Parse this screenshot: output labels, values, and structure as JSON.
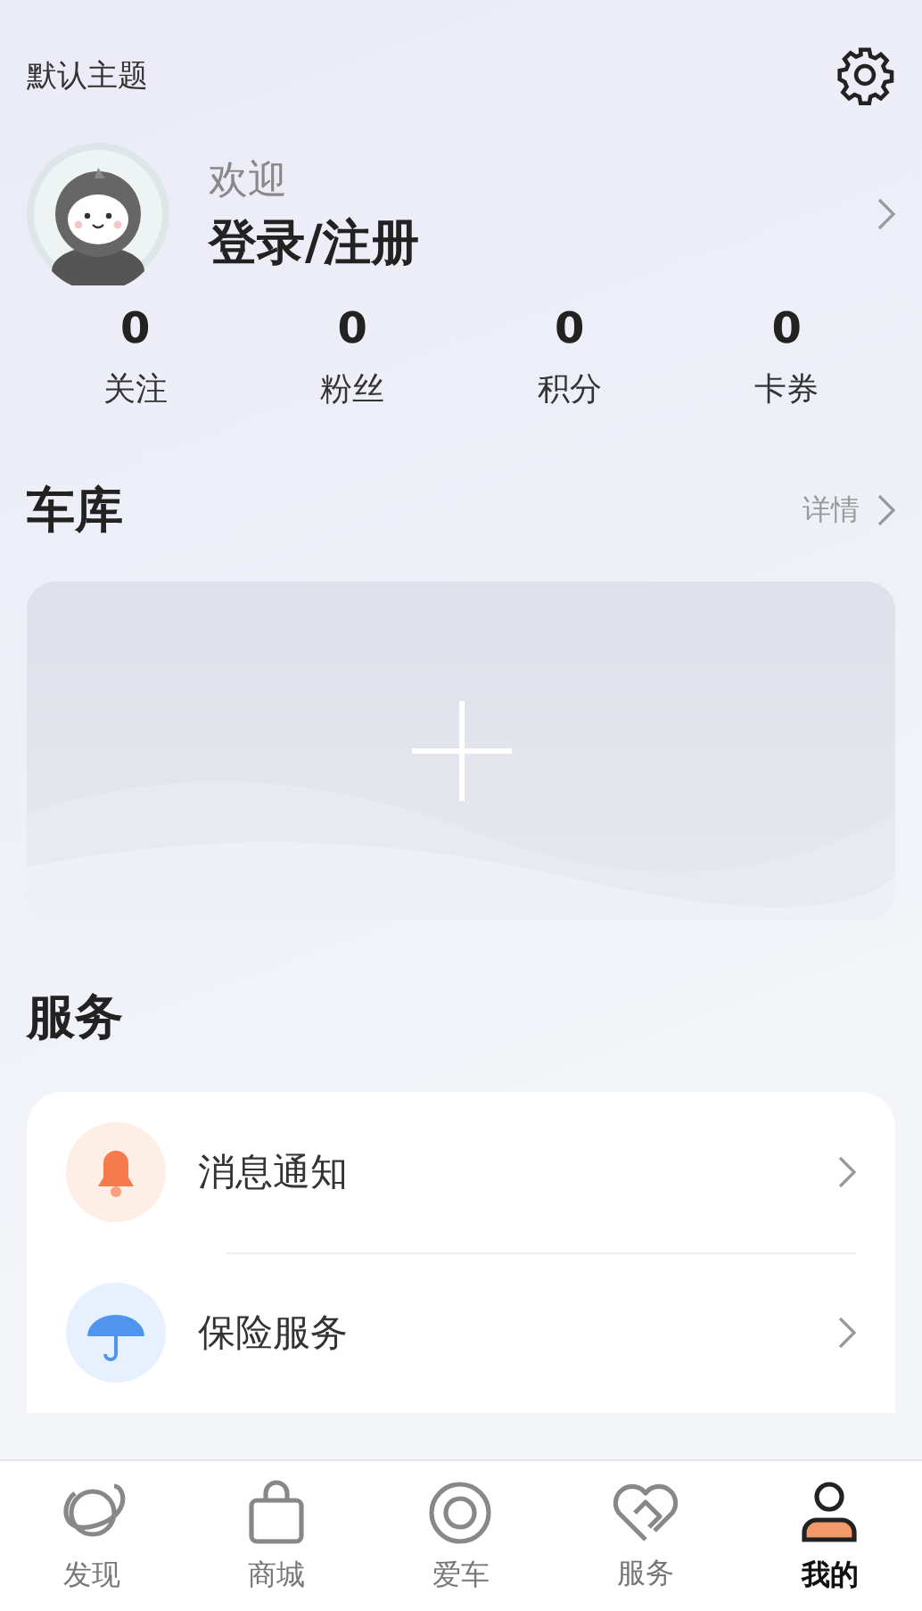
{
  "header": {
    "theme_label": "默认主题"
  },
  "profile": {
    "greeting": "欢迎",
    "login_link": "登录/注册"
  },
  "stats": [
    {
      "value": "0",
      "label": "关注"
    },
    {
      "value": "0",
      "label": "粉丝"
    },
    {
      "value": "0",
      "label": "积分"
    },
    {
      "value": "0",
      "label": "卡券"
    }
  ],
  "garage": {
    "title": "车库",
    "details_link": "详情"
  },
  "services": {
    "title": "服务",
    "items": [
      {
        "kind": "bell",
        "label": "消息通知"
      },
      {
        "kind": "umbrella",
        "label": "保险服务"
      }
    ]
  },
  "tab_bar": [
    {
      "kind": "planet",
      "label": "发现",
      "selected": false
    },
    {
      "kind": "bag",
      "label": "商城",
      "selected": false
    },
    {
      "kind": "target",
      "label": "爱车",
      "selected": false
    },
    {
      "kind": "heart",
      "label": "服务",
      "selected": false
    },
    {
      "kind": "person",
      "label": "我的",
      "selected": true
    }
  ]
}
